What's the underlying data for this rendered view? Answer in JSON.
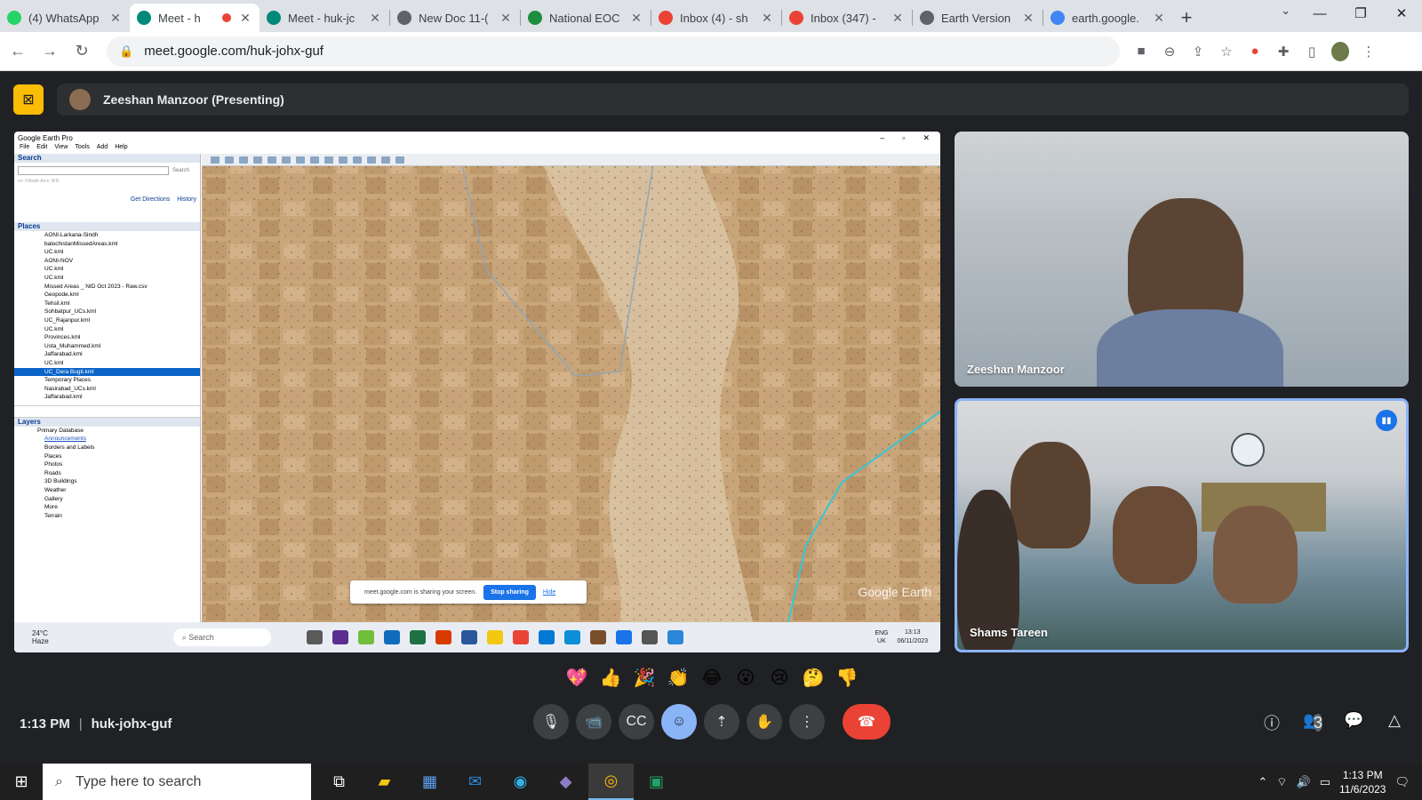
{
  "browser": {
    "tabs": [
      {
        "title": "(4) WhatsApp",
        "favicon_color": "#25d366"
      },
      {
        "title": "Meet - h",
        "favicon_color": "#00897b",
        "active": true,
        "recording": true
      },
      {
        "title": "Meet - huk-jc",
        "favicon_color": "#00897b"
      },
      {
        "title": "New Doc 11-(",
        "favicon_color": "#5f6368"
      },
      {
        "title": "National EOC",
        "favicon_color": "#1e8e3e"
      },
      {
        "title": "Inbox (4) - sh",
        "favicon_color": "#ea4335"
      },
      {
        "title": "Inbox (347) -",
        "favicon_color": "#ea4335"
      },
      {
        "title": "Earth Version",
        "favicon_color": "#5f6368"
      },
      {
        "title": "earth.google.",
        "favicon_color": "#4285f4"
      }
    ],
    "url": "meet.google.com/huk-johx-guf"
  },
  "meet": {
    "presenter_label": "Zeeshan Manzoor (Presenting)",
    "meeting_time": "1:13 PM",
    "meeting_code": "huk-johx-guf",
    "participant_count": "3",
    "tiles": [
      {
        "name": "Zeeshan Manzoor"
      },
      {
        "name": "Shams Tareen"
      }
    ],
    "reactions": [
      "💖",
      "👍",
      "🎉",
      "👏",
      "😂",
      "😮",
      "😢",
      "🤔",
      "👎"
    ]
  },
  "shared_screen": {
    "app_title": "Google Earth Pro",
    "menu": [
      "File",
      "Edit",
      "View",
      "Tools",
      "Add",
      "Help"
    ],
    "search_section": "Search",
    "search_button": "Search",
    "search_hint": "ex: Hillside Acre 3FR",
    "get_directions": "Get Directions",
    "history": "History",
    "places_section": "Places",
    "places": [
      "AONI-Larkana-Sindh",
      "balochistanMissedAreas.kml",
      "UC.kml",
      "AONI-NOV",
      "UC.kml",
      "UC.kml",
      "Missed Areas _ NID Oct 2023 - Raw.csv",
      "Geopode.kml",
      "Tehsil.kml",
      "Sohbatpur_UCs.kml",
      "UC_Rajanpur.kml",
      "UC.kml",
      "Provinces.kml",
      "Usta_Muhammed.kml",
      "Jaffarabad.kml",
      "UC.kml",
      "UC_Dera Bugti.kml",
      "Temporary Places",
      "Nasirabad_UCs.kml",
      "Jaffarabad.kml"
    ],
    "selected_place_index": 16,
    "layers_section": "Layers",
    "layers": [
      "Primary Database",
      "Announcements",
      "Borders and Labels",
      "Places",
      "Photos",
      "Roads",
      "3D Buildings",
      "Weather",
      "Gallery",
      "More",
      "Terrain"
    ],
    "brand": "Google Earth",
    "share_notice": "meet.google.com is sharing your screen.",
    "stop_sharing": "Stop sharing",
    "hide": "Hide",
    "weather": "24°C",
    "weather_desc": "Haze",
    "taskbar_search": "Search",
    "lang": "ENG",
    "region": "UK",
    "inner_time": "13:13",
    "inner_date": "06/11/2023"
  },
  "taskbar": {
    "search_placeholder": "Type here to search",
    "time": "1:13 PM",
    "date": "11/6/2023"
  }
}
